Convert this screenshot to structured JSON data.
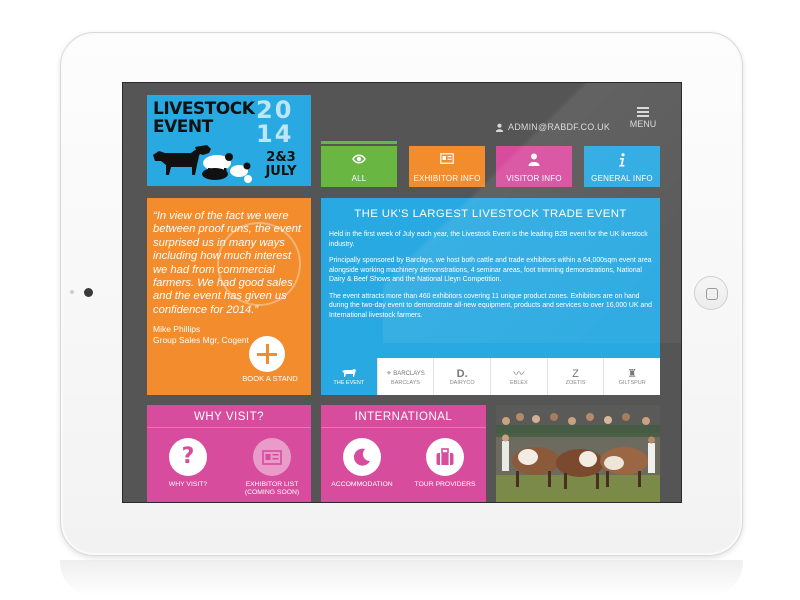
{
  "logo": {
    "line1": "LIVESTOCK",
    "line2": "EVENT",
    "year1": "20",
    "year2": "14",
    "dates": "2&3 JULY"
  },
  "header": {
    "user_email": "ADMIN@RABDF.CO.UK",
    "menu_label": "MENU"
  },
  "tabs": [
    {
      "label": "ALL",
      "icon": "eye-icon",
      "color": "#6ab643"
    },
    {
      "label": "EXHIBITOR INFO",
      "icon": "id-card-icon",
      "color": "#f28c2c"
    },
    {
      "label": "VISITOR INFO",
      "icon": "user-icon",
      "color": "#d74c9d"
    },
    {
      "label": "GENERAL INFO",
      "icon": "info-icon",
      "color": "#29a9e1"
    }
  ],
  "testimonial": {
    "quote": "“In view of the fact we were between proof runs, the event surprised us in many ways including how much interest we had from commercial farmers. We had good sales and the event has given us confidence for 2014.”",
    "author_name": "Mike Phillips",
    "author_title": "Group Sales Mgr, Cogent",
    "cta_label": "BOOK A STAND"
  },
  "main": {
    "title": "THE UK'S LARGEST LIVESTOCK TRADE EVENT",
    "paragraphs": [
      "Held in the first week of July each year, the Livestock Event is the leading B2B event for the UK livestock industry.",
      "Principally sponsored by Barclays, we host both cattle and trade exhibitors within a 64,000sqm event area alongside working machinery demonstrations, 4 seminar areas, foot trimming demonstrations, National Dairy & Beef Shows and the National Lleyn Competition.",
      "The event attracts more than 460 exhibitors covering 11 unique product zones. Exhibitors are on hand during the two-day event to demonstrate all-new equipment, products and services to over 16,000 UK and International livestock farmers."
    ]
  },
  "sponsors": [
    {
      "label": "THE EVENT",
      "mark": "▬",
      "active": true
    },
    {
      "label": "BARCLAYS",
      "mark": "⚜ BARCLAYS",
      "active": false
    },
    {
      "label": "DAIRYCO",
      "mark": "D.",
      "active": false
    },
    {
      "label": "EBLEX",
      "mark": "〰",
      "active": false
    },
    {
      "label": "ZOETIS",
      "mark": "Z",
      "active": false
    },
    {
      "label": "GILTSPUR",
      "mark": "♜",
      "active": false
    }
  ],
  "why_visit": {
    "title": "WHY VISIT?",
    "items": [
      {
        "label": "WHY VISIT?",
        "icon": "question-icon"
      },
      {
        "label": "EXHIBITOR LIST (COMING SOON)",
        "icon": "list-card-icon"
      }
    ]
  },
  "international": {
    "title": "INTERNATIONAL",
    "items": [
      {
        "label": "ACCOMMODATION",
        "icon": "moon-icon"
      },
      {
        "label": "TOUR PROVIDERS",
        "icon": "suitcase-icon"
      }
    ]
  },
  "colors": {
    "green": "#6ab643",
    "orange": "#f28c2c",
    "pink": "#d74c9d",
    "blue": "#29a9e1",
    "background": "#555556"
  }
}
